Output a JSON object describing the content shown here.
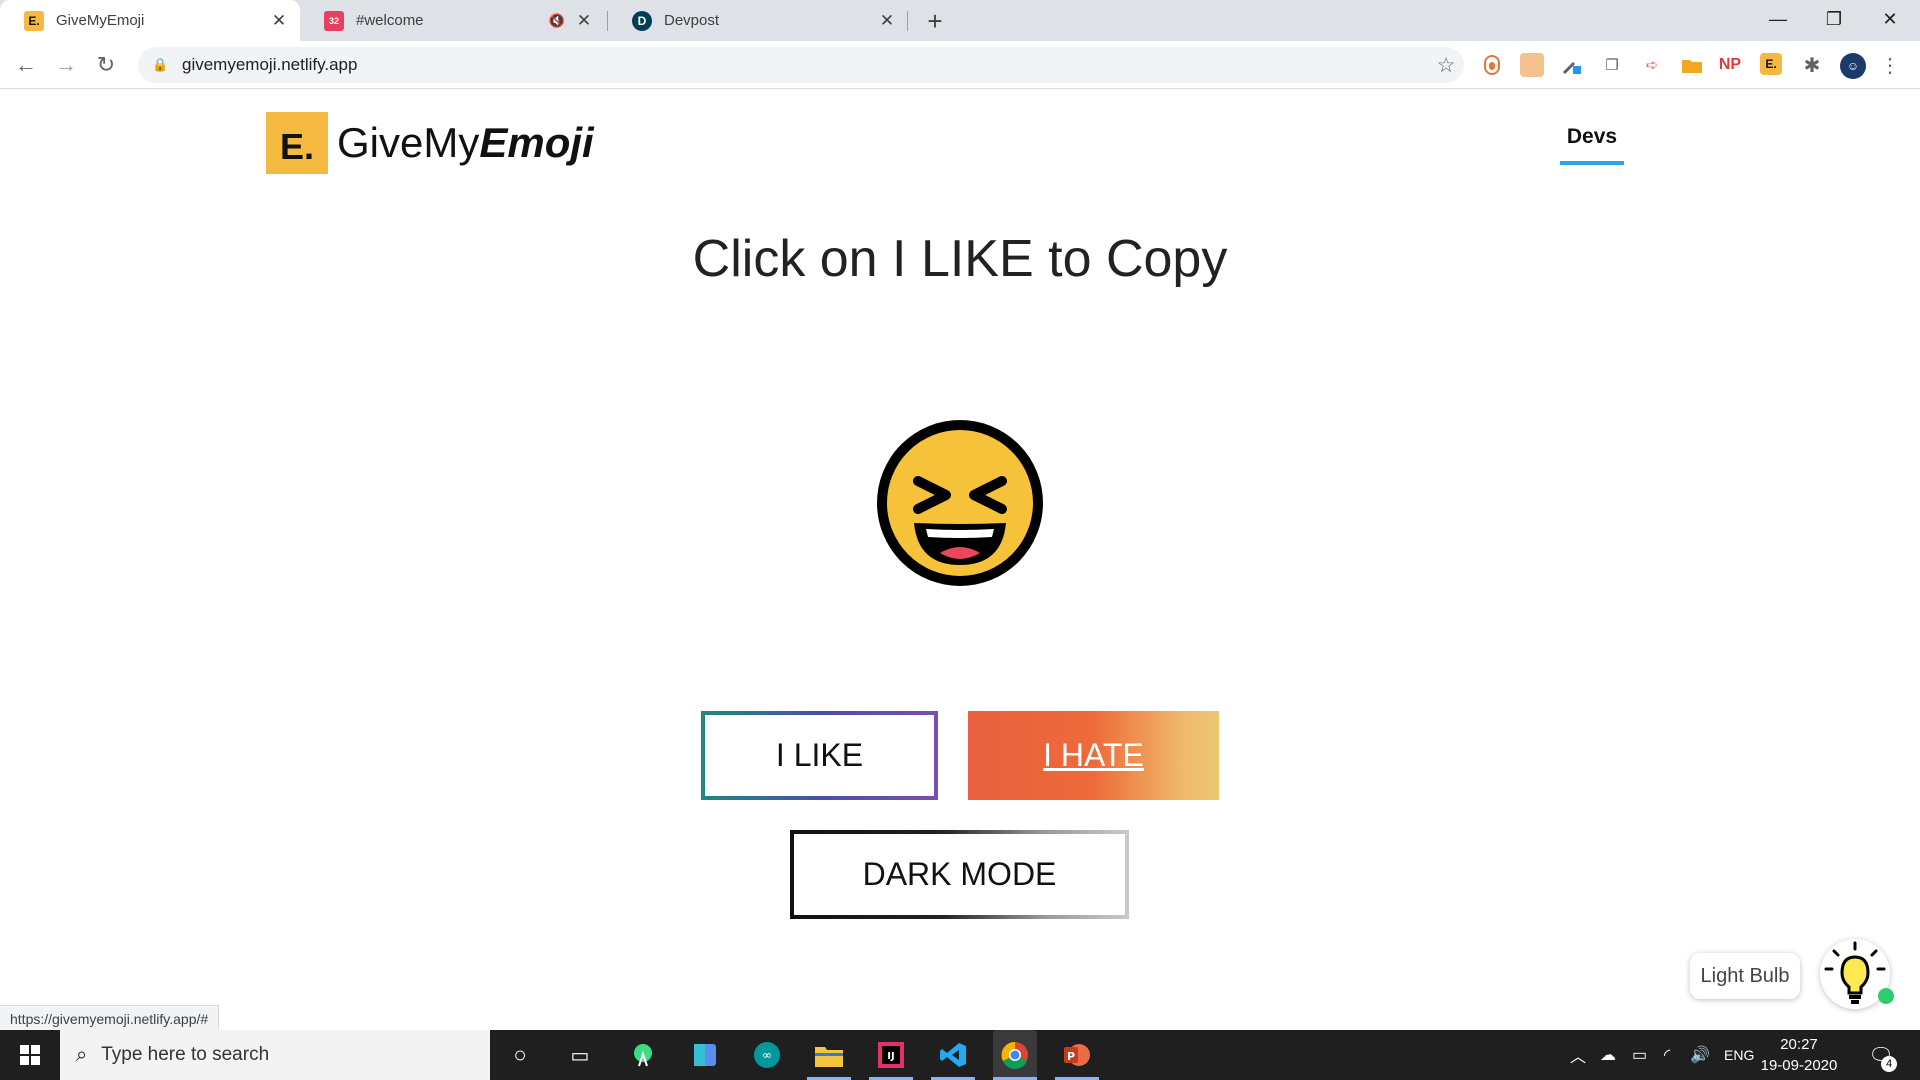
{
  "browser": {
    "tabs": [
      {
        "title": "GiveMyEmoji",
        "favicon": "E."
      },
      {
        "title": "#welcome",
        "favicon": "32"
      },
      {
        "title": "Devpost",
        "favicon": "D"
      }
    ],
    "new_tab": "+",
    "window_controls": {
      "minimize": "—",
      "restore": "❐",
      "close": "✕"
    },
    "url": "givemyemoji.netlify.app",
    "extensions": [
      "NP",
      "E."
    ],
    "status_url": "https://givemyemoji.netlify.app/#"
  },
  "site": {
    "logo_mark": "E.",
    "logo_text_plain": "GiveMy",
    "logo_text_italic": "Emoji",
    "nav_devs": "Devs",
    "headline": "Click on I LIKE to Copy",
    "buttons": {
      "like": "I LIKE",
      "hate": "I HATE",
      "dark_mode": "DARK MODE"
    },
    "lightbulb_label": "Light Bulb",
    "current_emoji": "grinning-squinting-face"
  },
  "colors": {
    "logo_yellow": "#f5b841",
    "devs_underline": "#2aa5e0",
    "emoji_yellow": "#f5c23a",
    "hate_start": "#e8603f",
    "hate_end": "#ecc873"
  },
  "taskbar": {
    "search_placeholder": "Type here to search",
    "tray_lang": "ENG",
    "time": "20:27",
    "date": "19-09-2020",
    "notification_count": "4"
  }
}
